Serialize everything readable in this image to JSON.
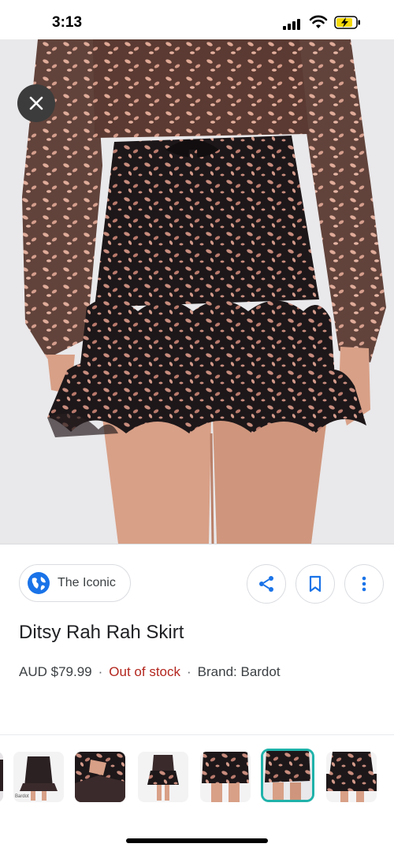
{
  "status_bar": {
    "time": "3:13"
  },
  "source": {
    "name": "The Iconic"
  },
  "product": {
    "title": "Ditsy Rah Rah Skirt",
    "price": "AUD $79.99",
    "separator": "·",
    "stock": "Out of stock",
    "brand": "Brand: Bardot"
  },
  "thumbnails": [
    {
      "caption": "",
      "selected": false
    },
    {
      "caption": "Bardot",
      "selected": false
    },
    {
      "caption": "",
      "selected": false
    },
    {
      "caption": "",
      "selected": false
    },
    {
      "caption": "",
      "selected": false
    },
    {
      "caption": "",
      "selected": true
    },
    {
      "caption": "",
      "selected": false
    }
  ],
  "colors": {
    "accent": "#1a73e8",
    "out_of_stock": "#b3261e",
    "selected_thumb": "#20b2aa"
  }
}
